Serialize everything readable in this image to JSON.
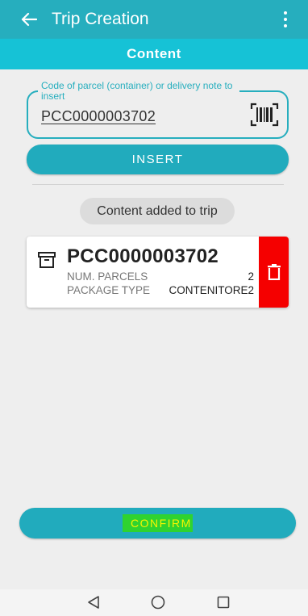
{
  "appbar": {
    "title": "Trip Creation",
    "back_icon": "arrow-left-icon",
    "menu_icon": "more-vertical-icon"
  },
  "subheader": {
    "title": "Content"
  },
  "code_field": {
    "label": "Code of parcel (container) or delivery note to insert",
    "value": "PCC0000003702",
    "action_icon": "barcode-scan-icon"
  },
  "insert_button": {
    "label": "INSERT"
  },
  "status_chip": {
    "text": "Content added to trip"
  },
  "content_item": {
    "icon": "archive-box-icon",
    "code": "PCC0000003702",
    "num_parcels_label": "NUM. PARCELS",
    "num_parcels_value": "2",
    "package_type_label": "PACKAGE TYPE",
    "package_type_value": "CONTENITORE2",
    "delete_icon": "trash-icon"
  },
  "confirm_button": {
    "label": "CONFIRM"
  },
  "system_nav": {
    "back_icon": "triangle-back-icon",
    "home_icon": "circle-home-icon",
    "recents_icon": "square-recents-icon"
  },
  "colors": {
    "appbar": "#26aebe",
    "subheader": "#16c2d6",
    "primary_button": "#21abbd",
    "delete": "#f50000",
    "highlight_bg": "#2fd32f",
    "highlight_text": "#f4f400"
  }
}
